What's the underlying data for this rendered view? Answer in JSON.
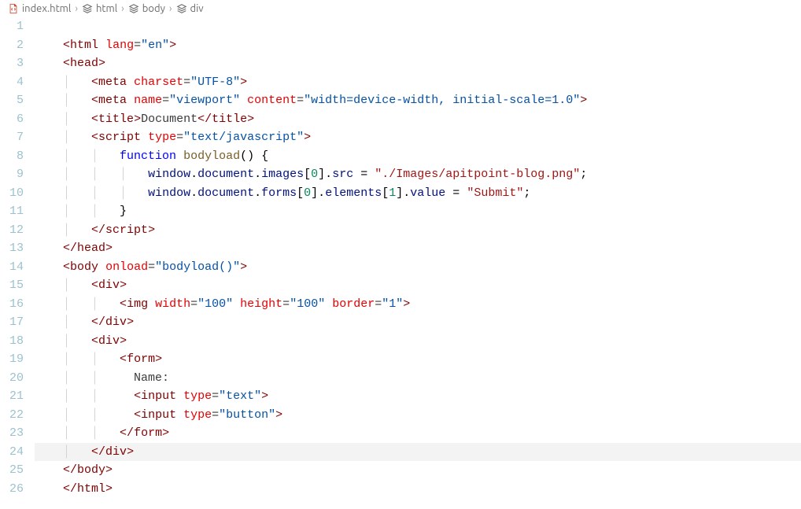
{
  "breadcrumb": {
    "items": [
      {
        "label": "index.html",
        "icon": "file-code"
      },
      {
        "label": "html",
        "icon": "symbol"
      },
      {
        "label": "body",
        "icon": "symbol"
      },
      {
        "label": "div",
        "icon": "symbol"
      }
    ]
  },
  "editor": {
    "line_start": 1,
    "line_end": 26,
    "highlight_line": 24,
    "lines": [
      {
        "n": 1,
        "indent": 0,
        "tokens": []
      },
      {
        "n": 2,
        "indent": 0,
        "tokens": [
          [
            "tag-bracket",
            "<"
          ],
          [
            "tag-name",
            "html"
          ],
          [
            "txt",
            " "
          ],
          [
            "attr-name",
            "lang"
          ],
          [
            "attr-eq",
            "="
          ],
          [
            "attr-val",
            "\"en\""
          ],
          [
            "tag-bracket",
            ">"
          ]
        ]
      },
      {
        "n": 3,
        "indent": 0,
        "tokens": [
          [
            "tag-bracket",
            "<"
          ],
          [
            "tag-name",
            "head"
          ],
          [
            "tag-bracket",
            ">"
          ]
        ]
      },
      {
        "n": 4,
        "indent": 1,
        "tokens": [
          [
            "tag-bracket",
            "<"
          ],
          [
            "tag-name",
            "meta"
          ],
          [
            "txt",
            " "
          ],
          [
            "attr-name",
            "charset"
          ],
          [
            "attr-eq",
            "="
          ],
          [
            "attr-val",
            "\"UTF-8\""
          ],
          [
            "tag-bracket",
            ">"
          ]
        ]
      },
      {
        "n": 5,
        "indent": 1,
        "tokens": [
          [
            "tag-bracket",
            "<"
          ],
          [
            "tag-name",
            "meta"
          ],
          [
            "txt",
            " "
          ],
          [
            "attr-name",
            "name"
          ],
          [
            "attr-eq",
            "="
          ],
          [
            "attr-val",
            "\"viewport\""
          ],
          [
            "txt",
            " "
          ],
          [
            "attr-name",
            "content"
          ],
          [
            "attr-eq",
            "="
          ],
          [
            "attr-val",
            "\"width=device-width, initial-scale=1.0\""
          ],
          [
            "tag-bracket",
            ">"
          ]
        ]
      },
      {
        "n": 6,
        "indent": 1,
        "tokens": [
          [
            "tag-bracket",
            "<"
          ],
          [
            "tag-name",
            "title"
          ],
          [
            "tag-bracket",
            ">"
          ],
          [
            "txt",
            "Document"
          ],
          [
            "tag-bracket",
            "</"
          ],
          [
            "tag-name",
            "title"
          ],
          [
            "tag-bracket",
            ">"
          ]
        ]
      },
      {
        "n": 7,
        "indent": 1,
        "tokens": [
          [
            "tag-bracket",
            "<"
          ],
          [
            "tag-name",
            "script"
          ],
          [
            "txt",
            " "
          ],
          [
            "attr-name",
            "type"
          ],
          [
            "attr-eq",
            "="
          ],
          [
            "attr-val",
            "\"text/javascript\""
          ],
          [
            "tag-bracket",
            ">"
          ]
        ]
      },
      {
        "n": 8,
        "indent": 2,
        "tokens": [
          [
            "kw",
            "function"
          ],
          [
            "txt",
            " "
          ],
          [
            "fn",
            "bodyload"
          ],
          [
            "punc",
            "()"
          ],
          [
            "txt",
            " "
          ],
          [
            "punc",
            "{"
          ]
        ]
      },
      {
        "n": 9,
        "indent": 3,
        "tokens": [
          [
            "var",
            "window"
          ],
          [
            "punc",
            "."
          ],
          [
            "prop",
            "document"
          ],
          [
            "punc",
            "."
          ],
          [
            "prop",
            "images"
          ],
          [
            "punc",
            "["
          ],
          [
            "num",
            "0"
          ],
          [
            "punc",
            "]."
          ],
          [
            "prop",
            "src"
          ],
          [
            "txt",
            " "
          ],
          [
            "punc",
            "="
          ],
          [
            "txt",
            " "
          ],
          [
            "str",
            "\"./Images/apitpoint-blog.png\""
          ],
          [
            "punc",
            ";"
          ]
        ]
      },
      {
        "n": 10,
        "indent": 3,
        "tokens": [
          [
            "var",
            "window"
          ],
          [
            "punc",
            "."
          ],
          [
            "prop",
            "document"
          ],
          [
            "punc",
            "."
          ],
          [
            "prop",
            "forms"
          ],
          [
            "punc",
            "["
          ],
          [
            "num",
            "0"
          ],
          [
            "punc",
            "]."
          ],
          [
            "prop",
            "elements"
          ],
          [
            "punc",
            "["
          ],
          [
            "num",
            "1"
          ],
          [
            "punc",
            "]."
          ],
          [
            "prop",
            "value"
          ],
          [
            "txt",
            " "
          ],
          [
            "punc",
            "="
          ],
          [
            "txt",
            " "
          ],
          [
            "str",
            "\"Submit\""
          ],
          [
            "punc",
            ";"
          ]
        ]
      },
      {
        "n": 11,
        "indent": 2,
        "tokens": [
          [
            "punc",
            "}"
          ]
        ]
      },
      {
        "n": 12,
        "indent": 1,
        "tokens": [
          [
            "tag-bracket",
            "</"
          ],
          [
            "tag-name",
            "script"
          ],
          [
            "tag-bracket",
            ">"
          ]
        ]
      },
      {
        "n": 13,
        "indent": 0,
        "tokens": [
          [
            "tag-bracket",
            "</"
          ],
          [
            "tag-name",
            "head"
          ],
          [
            "tag-bracket",
            ">"
          ]
        ]
      },
      {
        "n": 14,
        "indent": 0,
        "tokens": [
          [
            "tag-bracket",
            "<"
          ],
          [
            "tag-name",
            "body"
          ],
          [
            "txt",
            " "
          ],
          [
            "attr-name",
            "onload"
          ],
          [
            "attr-eq",
            "="
          ],
          [
            "attr-val",
            "\"bodyload()\""
          ],
          [
            "tag-bracket",
            ">"
          ]
        ]
      },
      {
        "n": 15,
        "indent": 1,
        "tokens": [
          [
            "tag-bracket",
            "<"
          ],
          [
            "tag-name",
            "div"
          ],
          [
            "tag-bracket",
            ">"
          ]
        ]
      },
      {
        "n": 16,
        "indent": 2,
        "tokens": [
          [
            "tag-bracket",
            "<"
          ],
          [
            "tag-name",
            "img"
          ],
          [
            "txt",
            " "
          ],
          [
            "attr-name",
            "width"
          ],
          [
            "attr-eq",
            "="
          ],
          [
            "attr-val",
            "\"100\""
          ],
          [
            "txt",
            " "
          ],
          [
            "attr-name",
            "height"
          ],
          [
            "attr-eq",
            "="
          ],
          [
            "attr-val",
            "\"100\""
          ],
          [
            "txt",
            " "
          ],
          [
            "attr-name",
            "border"
          ],
          [
            "attr-eq",
            "="
          ],
          [
            "attr-val",
            "\"1\""
          ],
          [
            "tag-bracket",
            ">"
          ]
        ]
      },
      {
        "n": 17,
        "indent": 1,
        "tokens": [
          [
            "tag-bracket",
            "</"
          ],
          [
            "tag-name",
            "div"
          ],
          [
            "tag-bracket",
            ">"
          ]
        ]
      },
      {
        "n": 18,
        "indent": 1,
        "tokens": [
          [
            "tag-bracket",
            "<"
          ],
          [
            "tag-name",
            "div"
          ],
          [
            "tag-bracket",
            ">"
          ]
        ]
      },
      {
        "n": 19,
        "indent": 2,
        "tokens": [
          [
            "tag-bracket",
            "<"
          ],
          [
            "tag-name",
            "form"
          ],
          [
            "tag-bracket",
            ">"
          ]
        ]
      },
      {
        "n": 20,
        "indent": 2,
        "tokens": [
          [
            "txt",
            "  Name:"
          ]
        ]
      },
      {
        "n": 21,
        "indent": 2,
        "tokens": [
          [
            "txt",
            "  "
          ],
          [
            "tag-bracket",
            "<"
          ],
          [
            "tag-name",
            "input"
          ],
          [
            "txt",
            " "
          ],
          [
            "attr-name",
            "type"
          ],
          [
            "attr-eq",
            "="
          ],
          [
            "attr-val",
            "\"text\""
          ],
          [
            "tag-bracket",
            ">"
          ]
        ]
      },
      {
        "n": 22,
        "indent": 2,
        "tokens": [
          [
            "txt",
            "  "
          ],
          [
            "tag-bracket",
            "<"
          ],
          [
            "tag-name",
            "input"
          ],
          [
            "txt",
            " "
          ],
          [
            "attr-name",
            "type"
          ],
          [
            "attr-eq",
            "="
          ],
          [
            "attr-val",
            "\"button\""
          ],
          [
            "tag-bracket",
            ">"
          ]
        ]
      },
      {
        "n": 23,
        "indent": 2,
        "tokens": [
          [
            "tag-bracket",
            "</"
          ],
          [
            "tag-name",
            "form"
          ],
          [
            "tag-bracket",
            ">"
          ]
        ]
      },
      {
        "n": 24,
        "indent": 1,
        "tokens": [
          [
            "tag-bracket",
            "</"
          ],
          [
            "tag-name",
            "div"
          ],
          [
            "tag-bracket",
            ">"
          ]
        ]
      },
      {
        "n": 25,
        "indent": 0,
        "tokens": [
          [
            "tag-bracket",
            "</"
          ],
          [
            "tag-name",
            "body"
          ],
          [
            "tag-bracket",
            ">"
          ]
        ]
      },
      {
        "n": 26,
        "indent": 0,
        "tokens": [
          [
            "tag-bracket",
            "</"
          ],
          [
            "tag-name",
            "html"
          ],
          [
            "tag-bracket",
            ">"
          ]
        ]
      }
    ]
  }
}
